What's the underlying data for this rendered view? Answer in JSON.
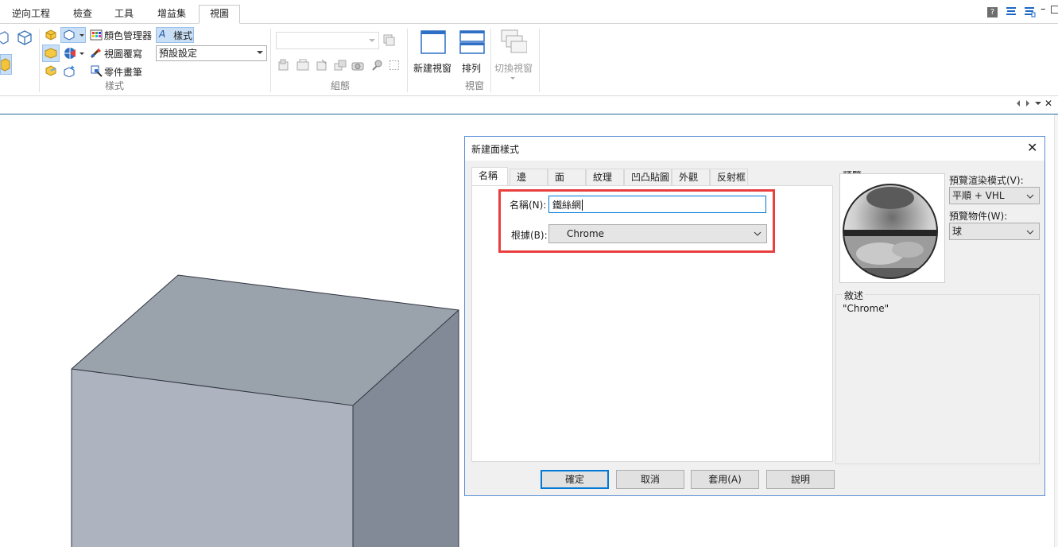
{
  "menu_tabs": [
    "逆向工程",
    "檢查",
    "工具",
    "增益集",
    "視圖"
  ],
  "ribbon": {
    "style_group": {
      "color_manager": "顏色管理器",
      "style_button": "樣式",
      "view_override": "視圖覆寫",
      "part_painter": "零件畫筆",
      "style_combo_value": "預設設定",
      "group_label": "樣式"
    },
    "assembly_group": {
      "group_label": "組態"
    },
    "window_group": {
      "new_window": "新建視窗",
      "arrange": "排列",
      "switch_window": "切換視窗",
      "group_label": "視窗"
    }
  },
  "dialog": {
    "title": "新建面樣式",
    "tabs": [
      "名稱",
      "邊",
      "面",
      "紋理",
      "凹凸貼圖",
      "外觀",
      "反射框"
    ],
    "name_label": "名稱(N):",
    "name_value": "鐵絲網",
    "based_on_label": "根據(B):",
    "based_on_value": "Chrome",
    "preview_label": "預覽",
    "render_mode_label": "預覽渲染模式(V):",
    "render_mode_value": "平順 + VHL",
    "preview_object_label": "預覽物件(W):",
    "preview_object_value": "球",
    "description_label": "敘述",
    "description_value": "\"Chrome\"",
    "buttons": {
      "ok": "確定",
      "cancel": "取消",
      "apply": "套用(A)",
      "help": "說明"
    }
  },
  "colors": {
    "highlight_box": "#e8403f",
    "accent": "#0078d7",
    "model_top": "#9aa2ab",
    "model_front": "#adb4bf",
    "model_side": "#838a97"
  }
}
